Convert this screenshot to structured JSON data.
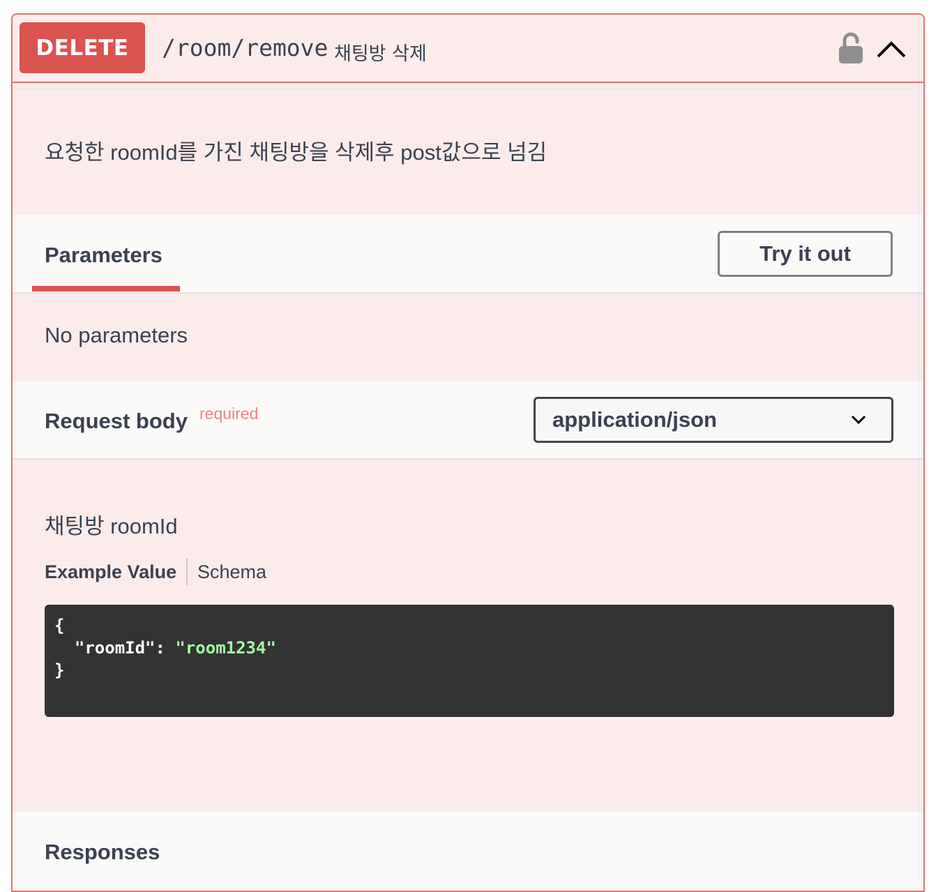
{
  "operation": {
    "method": "DELETE",
    "path": "/room/remove",
    "summary": "채팅방 삭제",
    "description": "요청한 roomId를 가진 채팅방을 삭제후 post값으로 넘김",
    "icons": {
      "lock": "unlocked-lock-icon",
      "collapse": "chevron-up-icon"
    }
  },
  "parameters": {
    "tab_label": "Parameters",
    "try_button_label": "Try it out",
    "empty_text": "No parameters"
  },
  "request_body": {
    "title": "Request body",
    "required_label": "required",
    "content_type": "application/json",
    "description": "채팅방 roomId",
    "example_tab_label": "Example Value",
    "schema_tab_label": "Schema",
    "example": {
      "open": "{",
      "key": "\"roomId\"",
      "colon": ": ",
      "value": "\"room1234\"",
      "close": "}"
    }
  },
  "responses": {
    "title": "Responses"
  },
  "colors": {
    "method_delete": "#d9534f",
    "block_background": "#fbeceb",
    "code_background": "#333333",
    "json_string": "#a2fca2",
    "required": "#e88883"
  }
}
